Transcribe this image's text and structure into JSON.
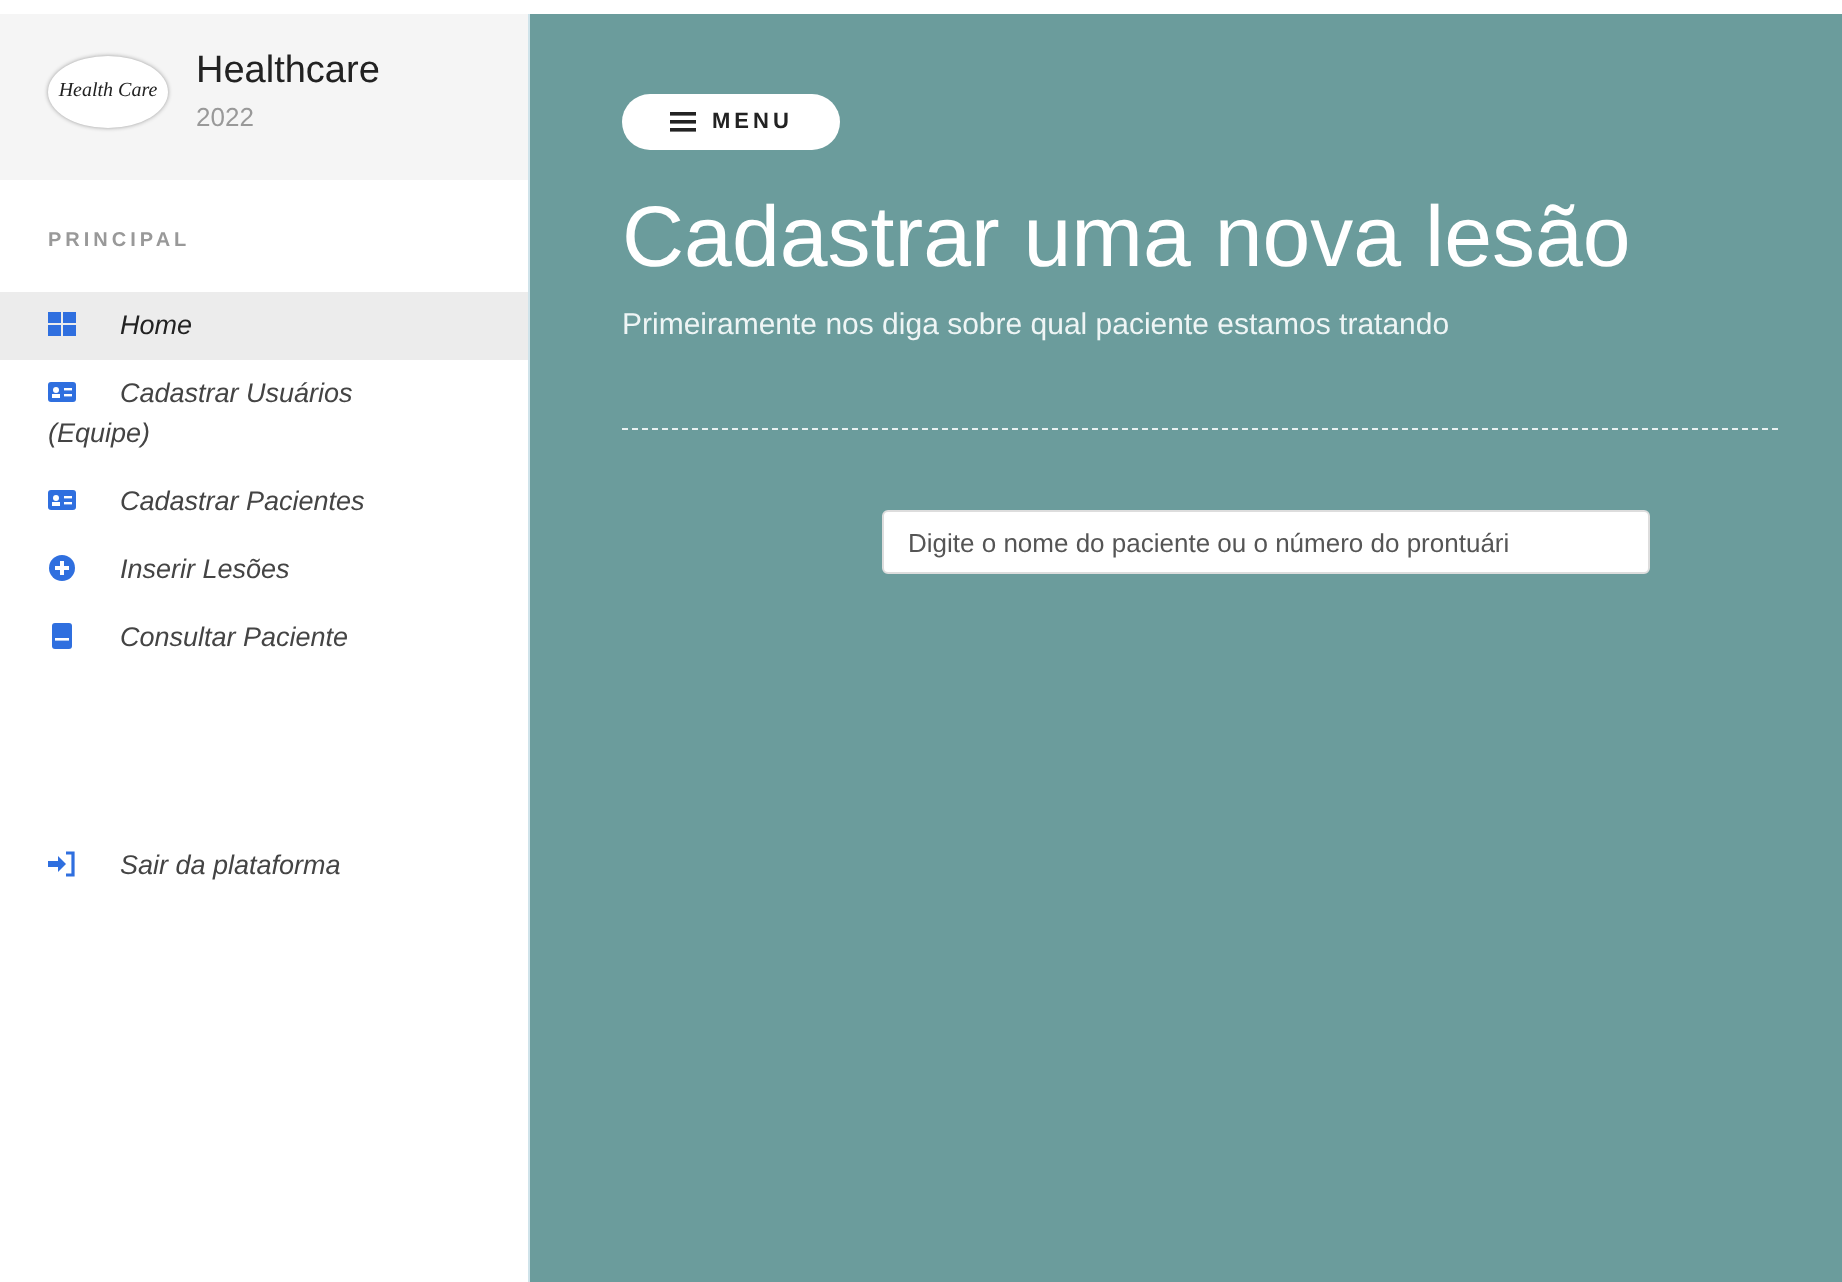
{
  "brand": {
    "logo_text": "Health Care",
    "title": "Healthcare",
    "year": "2022"
  },
  "sidebar": {
    "section": "PRINCIPAL",
    "items": [
      {
        "label": "Home",
        "selected": true
      },
      {
        "label": "Cadastrar Usuários (Equipe)",
        "selected": false
      },
      {
        "label": "Cadastrar Pacientes",
        "selected": false
      },
      {
        "label": "Inserir Lesões",
        "selected": false
      },
      {
        "label": "Consultar Paciente",
        "selected": false
      }
    ],
    "footer_item": {
      "label": "Sair da plataforma"
    }
  },
  "main": {
    "menu_button": "MENU",
    "title": "Cadastrar uma nova lesão",
    "subtitle": "Primeiramente nos diga sobre qual paciente estamos tratando",
    "search": {
      "placeholder": "Digite o nome do paciente ou o número do prontuári"
    }
  }
}
